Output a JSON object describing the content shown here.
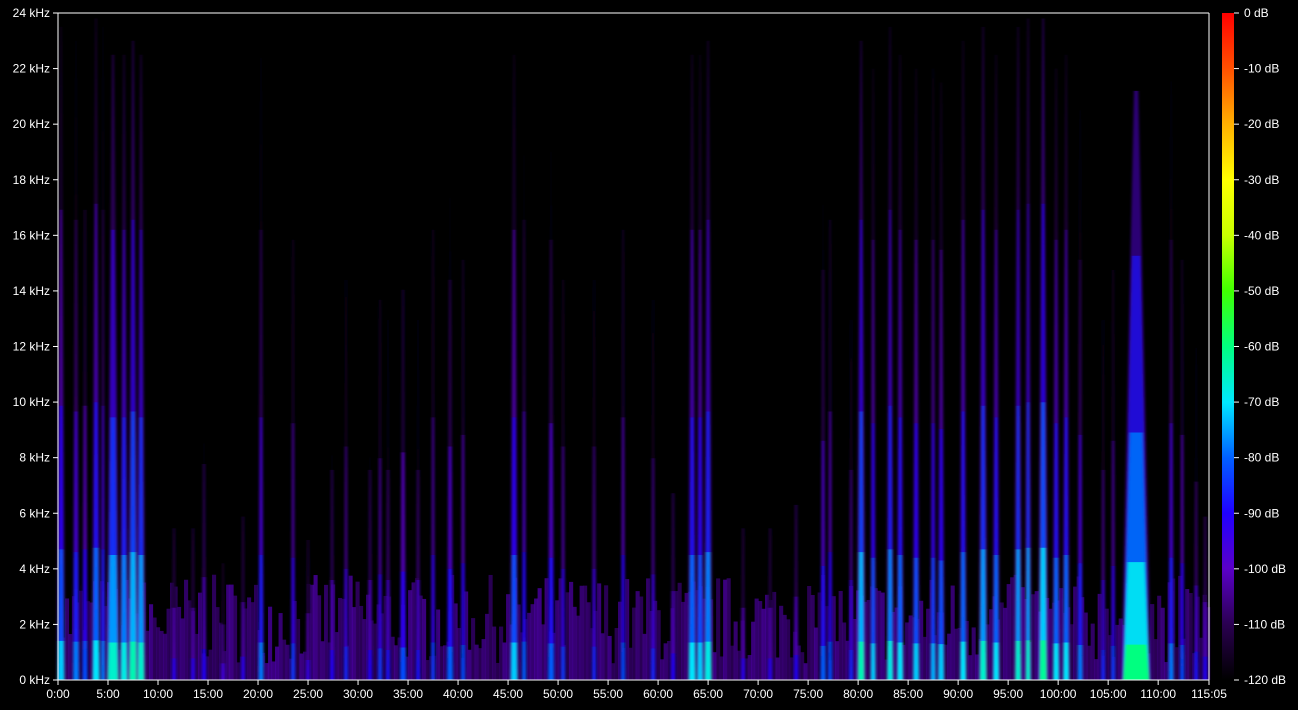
{
  "chart_data": {
    "type": "heatmap",
    "title": "",
    "xlabel": "",
    "ylabel": "",
    "x_ticks": [
      "0:00",
      "5:00",
      "10:00",
      "15:00",
      "20:00",
      "25:00",
      "30:00",
      "35:00",
      "40:00",
      "45:00",
      "50:00",
      "55:00",
      "60:00",
      "65:00",
      "70:00",
      "75:00",
      "80:00",
      "85:00",
      "90:00",
      "95:00",
      "100:00",
      "105:00",
      "110:00",
      "115:05"
    ],
    "x_range_minutes": [
      0,
      115.083
    ],
    "y_ticks": [
      "0 kHz",
      "2 kHz",
      "4 kHz",
      "6 kHz",
      "8 kHz",
      "10 kHz",
      "12 kHz",
      "14 kHz",
      "16 kHz",
      "18 kHz",
      "20 kHz",
      "22 kHz",
      "24 kHz"
    ],
    "y_range_khz": [
      0,
      24
    ],
    "colorbar": {
      "ticks": [
        "0 dB",
        "-10 dB",
        "-20 dB",
        "-30 dB",
        "-40 dB",
        "-50 dB",
        "-60 dB",
        "-70 dB",
        "-80 dB",
        "-90 dB",
        "-100 dB",
        "-110 dB",
        "-120 dB"
      ],
      "range_db": [
        -120,
        0
      ],
      "colors": [
        "#000000",
        "#2a0050",
        "#5a00c8",
        "#2000ff",
        "#0060ff",
        "#00e8ff",
        "#00ff80",
        "#40ff00",
        "#c8ff00",
        "#ffff00",
        "#ffb000",
        "#ff5000",
        "#ff0000"
      ]
    },
    "series": [
      {
        "x": 0.3,
        "w": 0.6,
        "top_khz": 23.5,
        "db": -72
      },
      {
        "x": 1.8,
        "w": 0.5,
        "top_khz": 23.0,
        "db": -78
      },
      {
        "x": 2.7,
        "w": 0.4,
        "top_khz": 23.5,
        "db": -82
      },
      {
        "x": 3.8,
        "w": 0.6,
        "top_khz": 23.8,
        "db": -70
      },
      {
        "x": 4.5,
        "w": 0.3,
        "top_khz": 23.5,
        "db": -78
      },
      {
        "x": 5.5,
        "w": 1.0,
        "top_khz": 22.5,
        "db": -66
      },
      {
        "x": 6.6,
        "w": 0.6,
        "top_khz": 22.5,
        "db": -68
      },
      {
        "x": 7.5,
        "w": 0.7,
        "top_khz": 23.0,
        "db": -64
      },
      {
        "x": 8.3,
        "w": 0.6,
        "top_khz": 22.5,
        "db": -66
      },
      {
        "x": 11.6,
        "w": 0.3,
        "top_khz": 13.0,
        "db": -92
      },
      {
        "x": 13.5,
        "w": 0.3,
        "top_khz": 13.0,
        "db": -92
      },
      {
        "x": 14.6,
        "w": 0.3,
        "top_khz": 18.5,
        "db": -90
      },
      {
        "x": 16.5,
        "w": 0.3,
        "top_khz": 10.0,
        "db": -96
      },
      {
        "x": 18.5,
        "w": 0.3,
        "top_khz": 14.0,
        "db": -92
      },
      {
        "x": 20.3,
        "w": 0.4,
        "top_khz": 22.5,
        "db": -78
      },
      {
        "x": 23.5,
        "w": 0.3,
        "top_khz": 22.0,
        "db": -84
      },
      {
        "x": 25.0,
        "w": 0.3,
        "top_khz": 12.0,
        "db": -94
      },
      {
        "x": 27.4,
        "w": 0.3,
        "top_khz": 18.0,
        "db": -90
      },
      {
        "x": 28.8,
        "w": 0.3,
        "top_khz": 20.0,
        "db": -86
      },
      {
        "x": 31.2,
        "w": 0.3,
        "top_khz": 18.0,
        "db": -90
      },
      {
        "x": 32.2,
        "w": 0.3,
        "top_khz": 19.0,
        "db": -84
      },
      {
        "x": 33.0,
        "w": 0.3,
        "top_khz": 18.0,
        "db": -88
      },
      {
        "x": 34.5,
        "w": 0.5,
        "top_khz": 19.5,
        "db": -82
      },
      {
        "x": 36.0,
        "w": 0.3,
        "top_khz": 18.0,
        "db": -88
      },
      {
        "x": 37.5,
        "w": 0.3,
        "top_khz": 22.5,
        "db": -84
      },
      {
        "x": 39.2,
        "w": 0.5,
        "top_khz": 20.0,
        "db": -80
      },
      {
        "x": 40.5,
        "w": 0.3,
        "top_khz": 21.0,
        "db": -82
      },
      {
        "x": 45.6,
        "w": 0.6,
        "top_khz": 22.5,
        "db": -72
      },
      {
        "x": 46.6,
        "w": 0.3,
        "top_khz": 23.0,
        "db": -80
      },
      {
        "x": 49.3,
        "w": 0.5,
        "top_khz": 22.0,
        "db": -80
      },
      {
        "x": 50.5,
        "w": 0.3,
        "top_khz": 20.0,
        "db": -84
      },
      {
        "x": 53.6,
        "w": 0.3,
        "top_khz": 20.0,
        "db": -86
      },
      {
        "x": 56.5,
        "w": 0.3,
        "top_khz": 22.5,
        "db": -82
      },
      {
        "x": 59.5,
        "w": 0.3,
        "top_khz": 19.0,
        "db": -86
      },
      {
        "x": 61.5,
        "w": 0.3,
        "top_khz": 16.0,
        "db": -90
      },
      {
        "x": 63.4,
        "w": 0.6,
        "top_khz": 22.5,
        "db": -70
      },
      {
        "x": 64.2,
        "w": 0.5,
        "top_khz": 22.5,
        "db": -72
      },
      {
        "x": 65.0,
        "w": 0.6,
        "top_khz": 23.0,
        "db": -68
      },
      {
        "x": 68.5,
        "w": 0.3,
        "top_khz": 13.0,
        "db": -92
      },
      {
        "x": 71.2,
        "w": 0.3,
        "top_khz": 13.0,
        "db": -92
      },
      {
        "x": 73.8,
        "w": 0.3,
        "top_khz": 15.0,
        "db": -90
      },
      {
        "x": 76.5,
        "w": 0.4,
        "top_khz": 20.5,
        "db": -80
      },
      {
        "x": 77.2,
        "w": 0.3,
        "top_khz": 23.0,
        "db": -82
      },
      {
        "x": 79.3,
        "w": 0.3,
        "top_khz": 18.0,
        "db": -86
      },
      {
        "x": 80.3,
        "w": 0.6,
        "top_khz": 23.0,
        "db": -64
      },
      {
        "x": 81.5,
        "w": 0.4,
        "top_khz": 22.0,
        "db": -72
      },
      {
        "x": 83.2,
        "w": 0.5,
        "top_khz": 23.5,
        "db": -68
      },
      {
        "x": 84.2,
        "w": 0.5,
        "top_khz": 22.5,
        "db": -70
      },
      {
        "x": 85.8,
        "w": 0.5,
        "top_khz": 22.0,
        "db": -72
      },
      {
        "x": 87.5,
        "w": 0.4,
        "top_khz": 22.0,
        "db": -74
      },
      {
        "x": 88.3,
        "w": 0.5,
        "top_khz": 21.5,
        "db": -72
      },
      {
        "x": 90.5,
        "w": 0.5,
        "top_khz": 23.0,
        "db": -70
      },
      {
        "x": 92.5,
        "w": 0.6,
        "top_khz": 23.5,
        "db": -66
      },
      {
        "x": 93.8,
        "w": 0.5,
        "top_khz": 22.5,
        "db": -70
      },
      {
        "x": 96.0,
        "w": 0.5,
        "top_khz": 23.5,
        "db": -66
      },
      {
        "x": 97.0,
        "w": 0.4,
        "top_khz": 23.8,
        "db": -66
      },
      {
        "x": 98.5,
        "w": 0.7,
        "top_khz": 23.8,
        "db": -62
      },
      {
        "x": 99.8,
        "w": 0.5,
        "top_khz": 22.0,
        "db": -70
      },
      {
        "x": 100.8,
        "w": 0.5,
        "top_khz": 22.5,
        "db": -70
      },
      {
        "x": 102.2,
        "w": 0.4,
        "top_khz": 21.0,
        "db": -78
      },
      {
        "x": 104.5,
        "w": 0.3,
        "top_khz": 18.0,
        "db": -86
      },
      {
        "x": 105.5,
        "w": 0.3,
        "top_khz": 20.5,
        "db": -84
      },
      {
        "x": 107.8,
        "w": 2.6,
        "top_khz": 21.2,
        "db": -60
      },
      {
        "x": 111.3,
        "w": 0.4,
        "top_khz": 22.0,
        "db": -78
      },
      {
        "x": 112.4,
        "w": 0.3,
        "top_khz": 21.0,
        "db": -82
      },
      {
        "x": 113.8,
        "w": 0.3,
        "top_khz": 17.0,
        "db": -88
      },
      {
        "x": 114.7,
        "w": 0.3,
        "top_khz": 14.0,
        "db": -90
      }
    ],
    "grid": false,
    "legend": "colorbar-right"
  }
}
